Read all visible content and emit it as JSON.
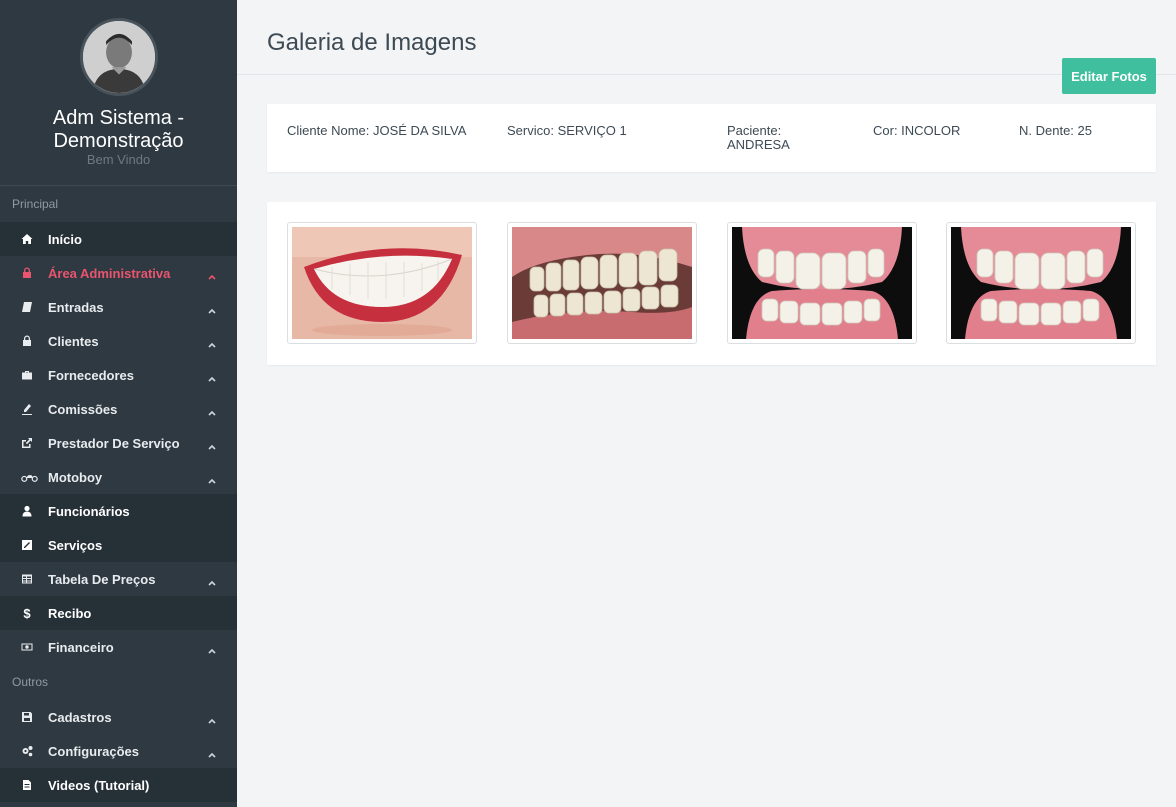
{
  "profile": {
    "name_line1": "Adm Sistema -",
    "name_line2": "Demonstração",
    "subtitle": "Bem Vindo"
  },
  "sidebar": {
    "section_principal": "Principal",
    "section_outros": "Outros",
    "items": [
      {
        "label": "Início",
        "icon": "home-icon"
      },
      {
        "label": "Área Administrativa",
        "icon": "lock-icon"
      },
      {
        "label": "Entradas",
        "icon": "book-icon"
      },
      {
        "label": "Clientes",
        "icon": "lock-icon"
      },
      {
        "label": "Fornecedores",
        "icon": "briefcase-icon"
      },
      {
        "label": "Comissões",
        "icon": "pen-icon"
      },
      {
        "label": "Prestador De Serviço",
        "icon": "share-icon"
      },
      {
        "label": "Motoboy",
        "icon": "motorcycle-icon"
      },
      {
        "label": "Funcionários",
        "icon": "user-icon"
      },
      {
        "label": "Serviços",
        "icon": "edit-icon"
      },
      {
        "label": "Tabela De Preços",
        "icon": "table-icon"
      },
      {
        "label": "Recibo",
        "icon": "dollar-icon"
      },
      {
        "label": "Financeiro",
        "icon": "money-icon"
      },
      {
        "label": "Cadastros",
        "icon": "save-icon"
      },
      {
        "label": "Configurações",
        "icon": "gears-icon"
      },
      {
        "label": "Videos (Tutorial)",
        "icon": "file-icon"
      }
    ]
  },
  "header": {
    "title": "Galeria de Imagens",
    "edit_button": "Editar Fotos"
  },
  "info": {
    "cliente": "Cliente Nome: JOSÉ DA SILVA",
    "servico": "Servico: SERVIÇO 1",
    "paciente_line1": "Paciente:",
    "paciente_line2": "ANDRESA",
    "cor": "Cor: INCOLOR",
    "dente": "N. Dente: 25"
  },
  "colors": {
    "sidebar_bg": "#2f3941",
    "active": "#e9556e",
    "button": "#3fbf9d"
  }
}
